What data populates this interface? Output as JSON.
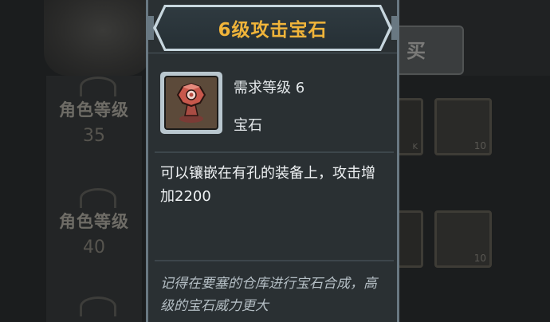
{
  "tooltip": {
    "title": "6级攻击宝石",
    "required_level": "需求等级 6",
    "item_type": "宝石",
    "description": "可以镶嵌在有孔的装备上，攻击增加2200",
    "hint": "记得在要塞的仓库进行宝石合成，高级的宝石威力更大",
    "item_icon": "red-attack-gem-icon"
  },
  "background": {
    "level_blocks": [
      {
        "label": "角色等级",
        "value": "35"
      },
      {
        "label": "角色等级",
        "value": "40"
      }
    ],
    "buy_button_label": "买",
    "slot_counts": [
      "10",
      "10"
    ],
    "partial_slot_label": "K"
  },
  "colors": {
    "title_gold": "#f0b43a",
    "panel_bg": "#2a3033",
    "frame": "#c7d6de"
  }
}
